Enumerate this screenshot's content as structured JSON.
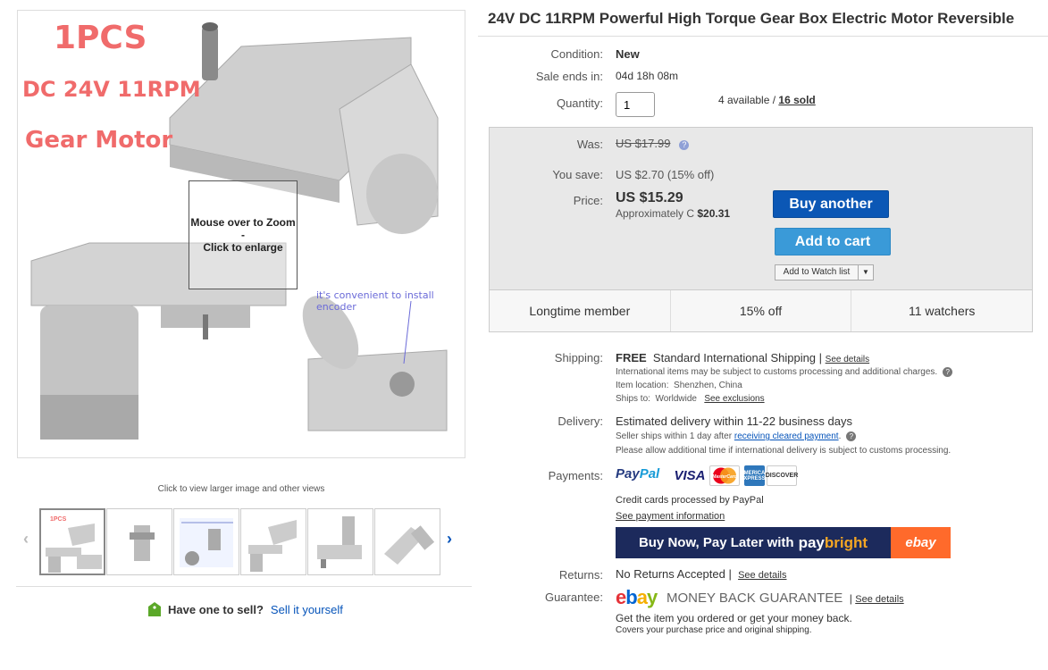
{
  "product": {
    "title": "24V DC 11RPM Powerful High Torque Gear Box Electric Motor Reversible",
    "image_overlay": {
      "line1": "1PCS",
      "line2": "DC 24V 11RPM",
      "line3": "Gear Motor",
      "encoder_note": "it's convenient to install encoder"
    },
    "zoom_hint": {
      "line1": "Mouse over to Zoom",
      "line2": "-",
      "line3": "Click to enlarge"
    },
    "image_caption": "Click to view larger image and other views",
    "thumbnail_count": 6
  },
  "sell": {
    "question": "Have one to sell?",
    "link": "Sell it yourself"
  },
  "details": {
    "condition_label": "Condition:",
    "condition_value": "New",
    "sale_label": "Sale ends in:",
    "sale_value": "04d 18h 08m",
    "quantity_label": "Quantity:",
    "quantity_value": "1",
    "available": "4 available",
    "separator": " / ",
    "sold": "16 sold"
  },
  "price": {
    "was_label": "Was:",
    "was_value": "US $17.99",
    "save_label": "You save:",
    "save_value": "US $2.70 (15% off)",
    "price_label": "Price:",
    "price_value": "US $15.29",
    "approx_text": "Approximately C",
    "approx_value": "$20.31",
    "buy_button": "Buy another",
    "cart_button": "Add to cart",
    "watch_button": "Add to Watch list"
  },
  "stats": [
    "Longtime member",
    "15% off",
    "11 watchers"
  ],
  "shipping": {
    "label": "Shipping:",
    "free": "FREE",
    "method": "Standard International Shipping",
    "see_details": "See details",
    "customs_note": "International items may be subject to customs processing and additional charges.",
    "location_label": "Item location:",
    "location": "Shenzhen, China",
    "ships_label": "Ships to:",
    "ships_to": "Worldwide",
    "see_exclusions": "See exclusions"
  },
  "delivery": {
    "label": "Delivery:",
    "estimate": "Estimated delivery within 11-22 business days",
    "note1_prefix": "Seller ships within 1 day after",
    "note1_link": "receiving cleared payment",
    "note2": "Please allow additional time if international delivery is subject to customs processing."
  },
  "payments": {
    "label": "Payments:",
    "paypal_a": "Pay",
    "paypal_b": "Pal",
    "visa": "VISA",
    "mastercard": "MasterCard",
    "amex": "AMERICAN EXPRESS",
    "discover": "DISCOVER",
    "cards_note": "Credit cards processed by PayPal",
    "payment_info_link": "See payment information",
    "banner_text": "Buy Now, Pay Later with",
    "banner_brand_a": "pay",
    "banner_brand_b": "bright",
    "banner_ebay": "ebay"
  },
  "returns": {
    "label": "Returns:",
    "value": "No Returns Accepted",
    "link": "See details"
  },
  "guarantee": {
    "label": "Guarantee:",
    "logo_e": "e",
    "logo_b": "b",
    "logo_a": "a",
    "logo_y": "y",
    "mbg": "MONEY BACK GUARANTEE",
    "link": "See details",
    "line1": "Get the item you ordered or get your money back.",
    "line2": "Covers your purchase price and original shipping."
  },
  "colors": {
    "accent_blue": "#0b57b5",
    "cart_blue": "#3a9ad8",
    "sold_red": "#cc0000",
    "overlay_red": "#f06b6b"
  }
}
